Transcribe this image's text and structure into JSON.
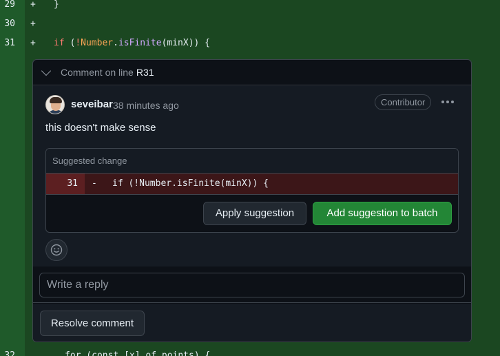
{
  "diff": {
    "lines": [
      {
        "num": "29",
        "sign": "+",
        "code": "}"
      },
      {
        "num": "30",
        "sign": "+",
        "code": ""
      },
      {
        "num": "31",
        "sign": "+",
        "code_parts": [
          "if",
          " (",
          "!",
          "Number",
          ".",
          "isFinite",
          "(minX)) {"
        ]
      }
    ],
    "bottom_line": {
      "num": "32",
      "code": "for (const [x] of points) {"
    }
  },
  "thread": {
    "header_label": "Comment on line",
    "line_ref": "R31",
    "comment": {
      "author": "seveibar",
      "time": "38 minutes ago",
      "badge": "Contributor",
      "body": "this doesn't make sense"
    },
    "suggestion": {
      "header": "Suggested change",
      "line_num": "31",
      "sign": "-",
      "code": "if (!Number.isFinite(minX)) {",
      "apply_label": "Apply suggestion",
      "batch_label": "Add suggestion to batch"
    },
    "reply": {
      "placeholder": "Write a reply"
    },
    "resolve_label": "Resolve comment"
  },
  "colors": {
    "added_line_bg": "#1b4721",
    "added_gutter_bg": "#1f5a2a",
    "removed_line_bg": "#3c1618",
    "primary_button": "#238636"
  },
  "icons": {
    "collapse": "chevron-down-icon",
    "more": "kebab-horizontal-icon",
    "emoji": "smiley-icon"
  }
}
